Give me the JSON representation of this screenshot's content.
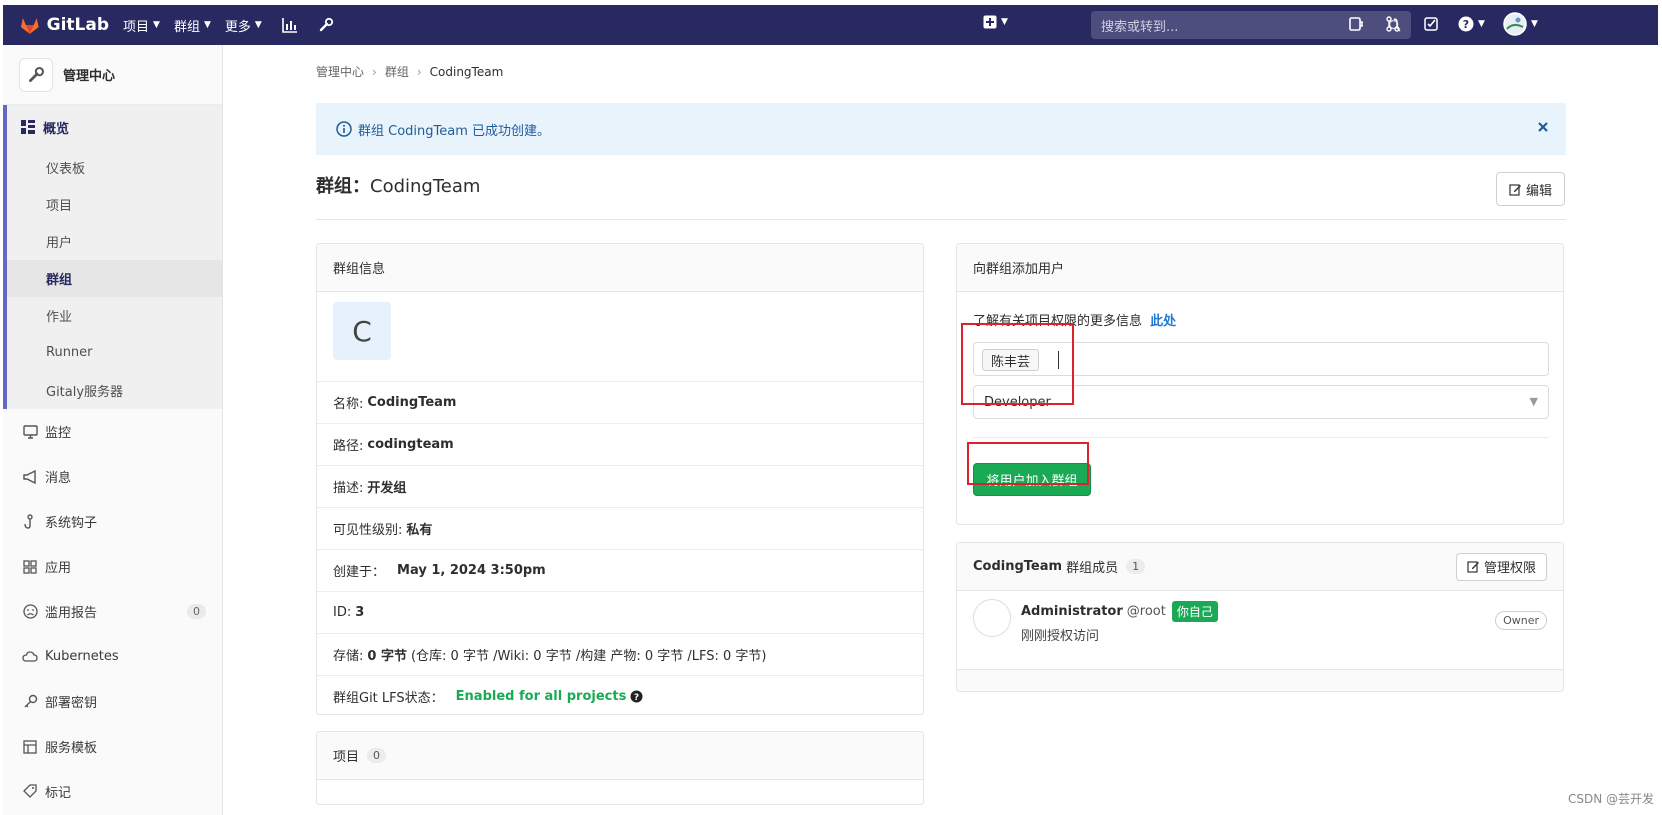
{
  "topbar": {
    "brand": "GitLab",
    "nav": [
      "项目",
      "群组",
      "更多"
    ],
    "search_placeholder": "搜索或转到..."
  },
  "sidebar": {
    "title": "管理中心",
    "overview": "概览",
    "sub_items": [
      "仪表板",
      "项目",
      "用户",
      "群组",
      "作业",
      "Runner",
      "Gitaly服务器"
    ],
    "items": [
      {
        "label": "监控",
        "icon": "monitor-icon"
      },
      {
        "label": "消息",
        "icon": "megaphone-icon"
      },
      {
        "label": "系统钩子",
        "icon": "hook-icon"
      },
      {
        "label": "应用",
        "icon": "apps-icon"
      },
      {
        "label": "滥用报告",
        "icon": "sad-face-icon",
        "badge": "0"
      },
      {
        "label": "Kubernetes",
        "icon": "kubernetes-icon"
      },
      {
        "label": "部署密钥",
        "icon": "key-icon"
      },
      {
        "label": "服务模板",
        "icon": "template-icon"
      },
      {
        "label": "标记",
        "icon": "tag-icon"
      }
    ]
  },
  "breadcrumb": [
    "管理中心",
    "群组",
    "CodingTeam"
  ],
  "alert": {
    "text": "群组 CodingTeam 已成功创建。"
  },
  "page": {
    "title_prefix": "群组：",
    "title_name": "CodingTeam",
    "edit_label": "编辑"
  },
  "group_info": {
    "header": "群组信息",
    "avatar_letter": "C",
    "rows": [
      {
        "label": "名称:",
        "value": "CodingTeam"
      },
      {
        "label": "路径:",
        "value": "codingteam"
      },
      {
        "label": "描述:",
        "value": "开发组"
      },
      {
        "label": "可见性级别:",
        "value": "私有"
      },
      {
        "label": "创建于：",
        "value": "May 1, 2024 3:50pm"
      },
      {
        "label": "ID:",
        "value": "3"
      }
    ],
    "storage_label": "存储:",
    "storage_value": "0 字节",
    "storage_detail": "(仓库: 0 字节 /Wiki: 0 字节 /构建 产物: 0 字节 /LFS: 0 字节)",
    "lfs_label": "群组Git LFS状态：",
    "lfs_value": "Enabled for all projects"
  },
  "projects": {
    "header": "项目",
    "count": "0"
  },
  "add_user": {
    "header": "向群组添加用户",
    "info_text": "了解有关项目权限的更多信息",
    "info_link": "此处",
    "token": "陈丰芸",
    "role": "Developer",
    "submit_label": "将用户加入群组"
  },
  "members": {
    "group_name": "CodingTeam",
    "title_suffix": "群组成员",
    "count": "1",
    "manage_label": "管理权限",
    "list": [
      {
        "name": "Administrator",
        "username": "@root",
        "self_badge": "你自己",
        "note": "刚刚授权访问",
        "role": "Owner"
      }
    ]
  },
  "watermark": "CSDN @芸开发",
  "colors": {
    "topbar": "#292961",
    "green": "#1aaa55",
    "alert_bg": "#e9f3fc",
    "highlight": "#d9232d"
  }
}
